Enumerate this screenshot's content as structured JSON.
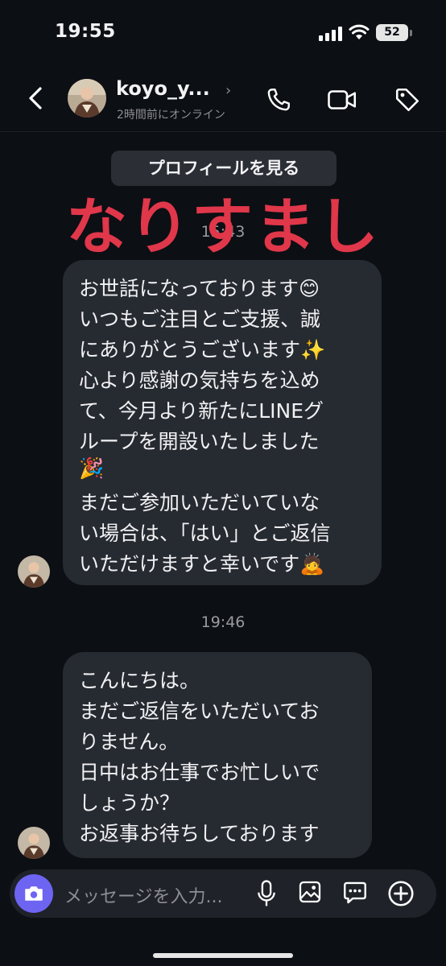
{
  "status_bar": {
    "time": "19:55",
    "battery": "52"
  },
  "header": {
    "name": "koyo_y...",
    "status": "2時間前にオンライン"
  },
  "profile_button": "プロフィールを見る",
  "overlay_label": "なりすまし",
  "messages": [
    {
      "time": "15:43",
      "lines": [
        "お世話になっております😊",
        "いつもご注目とご支援、誠",
        "にありがとうございます✨",
        "心より感謝の気持ちを込め",
        "て、今月より新たにLINEグ",
        "ループを開設いたしました",
        "🎉",
        "まだご参加いただいていな",
        "い場合は、「はい」とご返信",
        "いただけますと幸いです🙇"
      ]
    },
    {
      "time": "19:46",
      "lines": [
        "こんにちは。",
        "まだご返信をいただいてお",
        "りません。",
        "日中はお仕事でお忙しいで",
        "しょうか？",
        "お返事お待ちしております"
      ]
    }
  ],
  "composer": {
    "placeholder": "メッセージを入力..."
  },
  "icons": [
    "back-arrow-icon",
    "phone-icon",
    "video-camera-icon",
    "tag-icon",
    "camera-icon",
    "microphone-icon",
    "image-icon",
    "sticker-icon",
    "plus-icon"
  ],
  "colors": {
    "background": "#0c0f14",
    "bubble": "#262a31",
    "overlay_text": "#e0374a",
    "accent": "#6d64f2"
  }
}
